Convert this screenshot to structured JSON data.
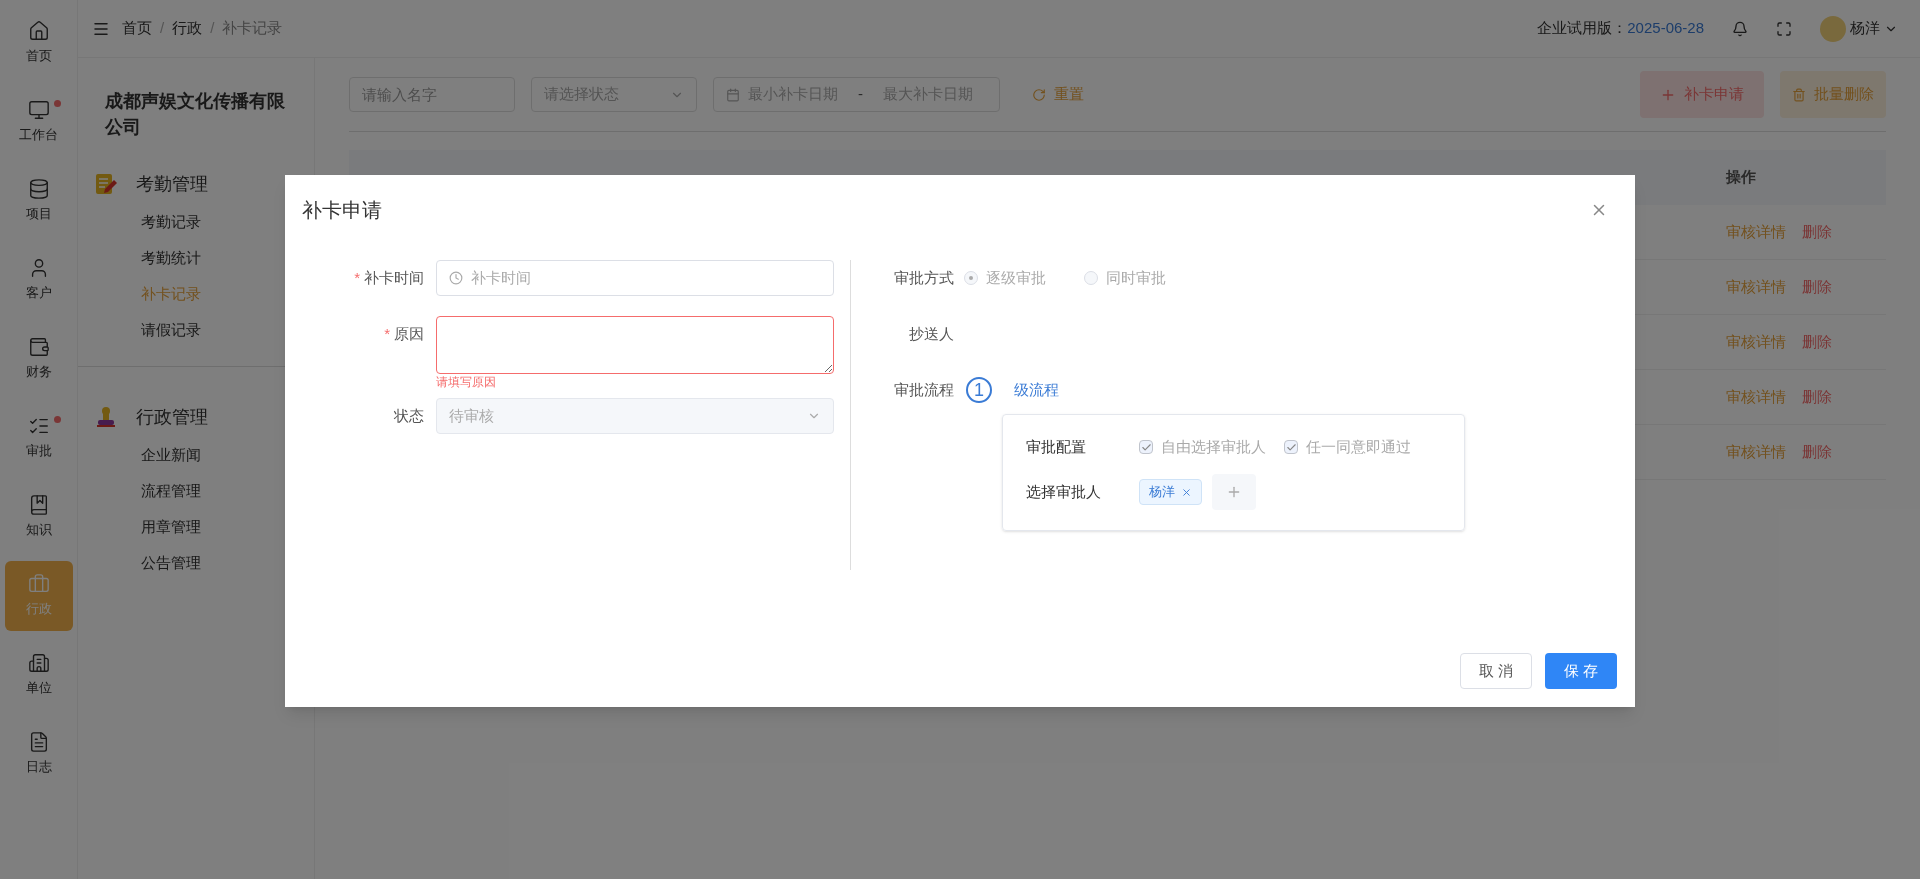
{
  "sidebar_rail": [
    {
      "label": "首页",
      "selected": false,
      "badge": false
    },
    {
      "label": "工作台",
      "selected": false,
      "badge": true
    },
    {
      "label": "项目",
      "selected": false,
      "badge": false
    },
    {
      "label": "客户",
      "selected": false,
      "badge": false
    },
    {
      "label": "财务",
      "selected": false,
      "badge": false
    },
    {
      "label": "审批",
      "selected": false,
      "badge": true
    },
    {
      "label": "知识",
      "selected": false,
      "badge": false
    },
    {
      "label": "行政",
      "selected": true,
      "badge": false
    },
    {
      "label": "单位",
      "selected": false,
      "badge": false
    },
    {
      "label": "日志",
      "selected": false,
      "badge": false
    }
  ],
  "company": "成都声娱文化传播有限公司",
  "nav_groups": [
    {
      "title": "考勤管理",
      "items": [
        {
          "label": "考勤记录",
          "selected": false
        },
        {
          "label": "考勤统计",
          "selected": false
        },
        {
          "label": "补卡记录",
          "selected": true
        },
        {
          "label": "请假记录",
          "selected": false
        }
      ]
    },
    {
      "title": "行政管理",
      "items": [
        {
          "label": "企业新闻",
          "selected": false
        },
        {
          "label": "流程管理",
          "selected": false
        },
        {
          "label": "用章管理",
          "selected": false
        },
        {
          "label": "公告管理",
          "selected": false
        }
      ]
    }
  ],
  "breadcrumb": {
    "items": [
      "首页",
      "行政",
      "补卡记录"
    ],
    "separators": [
      "/",
      "/"
    ]
  },
  "header": {
    "trial_label": "企业试用版：",
    "trial_date": "2025-06-28",
    "user": "杨洋"
  },
  "filters": {
    "name": {
      "placeholder": "请输入名字"
    },
    "status": {
      "placeholder": "请选择状态"
    },
    "date_range": {
      "start_placeholder": "最小补卡日期",
      "separator": "-",
      "end_placeholder": "最大补卡日期"
    },
    "reset": "重置"
  },
  "actions": [
    {
      "label": "补卡申请",
      "kind": "add"
    },
    {
      "label": "批量删除",
      "kind": "delete"
    }
  ],
  "table": {
    "columns": [
      "操作"
    ],
    "rows": [
      {
        "actions": [
          "审核详情",
          "删除"
        ]
      },
      {
        "actions": [
          "审核详情",
          "删除"
        ]
      },
      {
        "actions": [
          "审核详情",
          "删除"
        ]
      },
      {
        "actions": [
          "审核详情",
          "删除"
        ]
      },
      {
        "actions": [
          "审核详情",
          "删除"
        ]
      }
    ]
  },
  "dialog": {
    "title": "补卡申请",
    "fields": [
      {
        "kind": "time",
        "label": "补卡时间",
        "required_mark": "*",
        "placeholder": "补卡时间"
      },
      {
        "kind": "textarea",
        "label": "原因",
        "required_mark": "*",
        "error": "请填写原因"
      },
      {
        "kind": "select",
        "label": "状态",
        "value": "待审核",
        "disabled": true
      }
    ],
    "approval": {
      "method_label": "审批方式",
      "methods": [
        {
          "label": "逐级审批",
          "selected": true
        },
        {
          "label": "同时审批",
          "selected": false
        }
      ],
      "cc_label": "抄送人",
      "flow_label": "审批流程",
      "step": "1",
      "step_text": "级流程",
      "config_label": "审批配置",
      "options": [
        {
          "label": "自由选择审批人",
          "checked": true
        },
        {
          "label": "任一同意即通过",
          "checked": true
        }
      ],
      "approver_label": "选择审批人",
      "approvers": [
        "杨洋"
      ]
    },
    "buttons": [
      {
        "label": "取 消",
        "kind": "default"
      },
      {
        "label": "保 存",
        "kind": "primary"
      }
    ]
  }
}
